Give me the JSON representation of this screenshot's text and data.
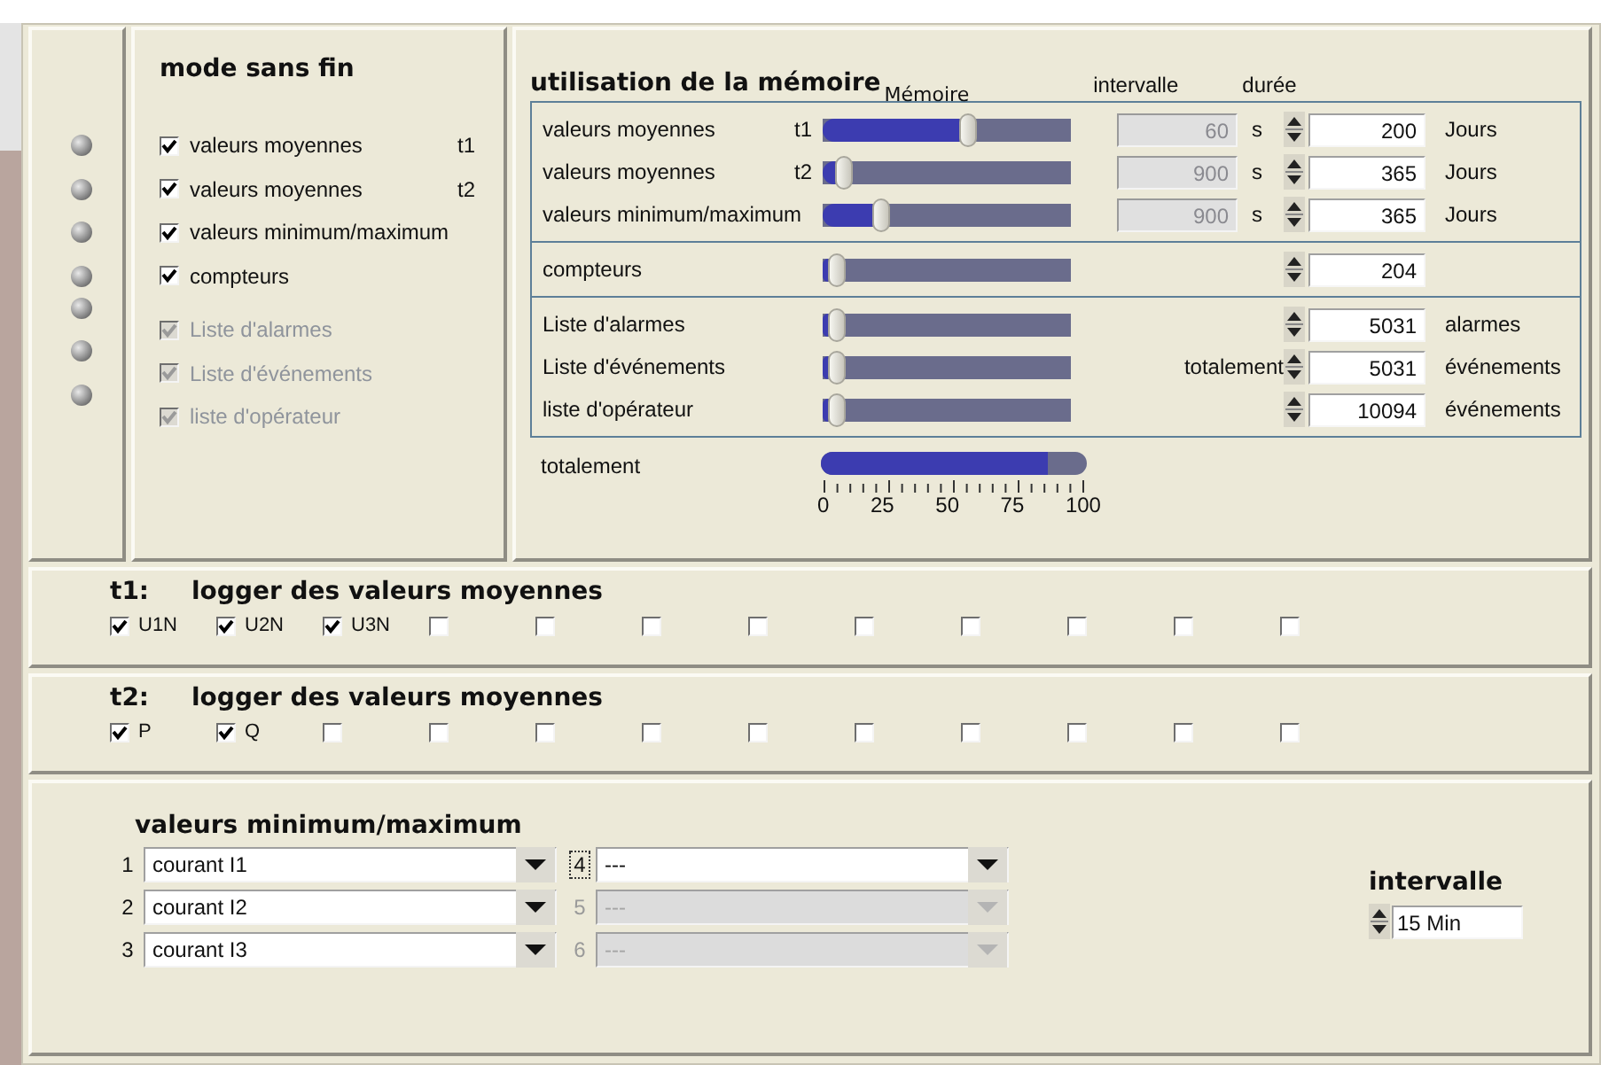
{
  "mode_panel": {
    "title": "mode sans fin",
    "groups": [
      {
        "items": [
          {
            "label": "valeurs moyennes",
            "suffix": "t1",
            "checked": true,
            "disabled": false
          },
          {
            "label": "valeurs moyennes",
            "suffix": "t2",
            "checked": true,
            "disabled": false
          },
          {
            "label": "valeurs minimum/maximum",
            "checked": true,
            "disabled": false
          },
          {
            "label": "compteurs",
            "checked": true,
            "disabled": false
          }
        ]
      },
      {
        "items": [
          {
            "label": "Liste d'alarmes",
            "checked": true,
            "disabled": true
          },
          {
            "label": "Liste d'événements",
            "checked": true,
            "disabled": true
          },
          {
            "label": "liste d'opérateur",
            "checked": true,
            "disabled": true
          }
        ]
      }
    ]
  },
  "memory_panel": {
    "title": "utilisation de la mémoire",
    "headers": [
      "Mémoire",
      "intervalle",
      "durée"
    ],
    "groups": [
      {
        "rows": [
          {
            "label": "valeurs moyennes",
            "tag": "t1",
            "level": 0.55,
            "interval": {
              "value": "60",
              "unit": "s",
              "disabled": true
            },
            "duration": "200",
            "unit": "Jours"
          },
          {
            "label": "valeurs moyennes",
            "tag": "t2",
            "level": 0.05,
            "interval": {
              "value": "900",
              "unit": "s",
              "disabled": true
            },
            "duration": "365",
            "unit": "Jours"
          },
          {
            "label": "valeurs minimum/maximum",
            "level": 0.2,
            "interval": {
              "value": "900",
              "unit": "s",
              "disabled": true
            },
            "duration": "365",
            "unit": "Jours"
          }
        ]
      },
      {
        "rows": [
          {
            "label": "compteurs",
            "level": 0.02,
            "duration": "204"
          }
        ]
      },
      {
        "rows": [
          {
            "label": "Liste d'alarmes",
            "level": 0.02,
            "duration": "5031",
            "unit": "alarmes"
          },
          {
            "label": "Liste d'événements",
            "level": 0.02,
            "side_label": "totalement",
            "duration": "5031",
            "unit": "événements"
          },
          {
            "label": "liste d'opérateur",
            "level": 0.02,
            "duration": "10094",
            "unit": "événements"
          }
        ]
      }
    ],
    "total": {
      "label": "totalement",
      "level": 0.85,
      "ticks": [
        "0",
        "25",
        "50",
        "75",
        "100"
      ]
    }
  },
  "loggers": [
    {
      "tag": "t1:",
      "title": "logger des valeurs moyennes",
      "channels": [
        {
          "label": "U1N",
          "checked": true
        },
        {
          "label": "U2N",
          "checked": true
        },
        {
          "label": "U3N",
          "checked": true
        },
        {
          "checked": false
        },
        {
          "checked": false
        },
        {
          "checked": false
        },
        {
          "checked": false
        },
        {
          "checked": false
        },
        {
          "checked": false
        },
        {
          "checked": false
        },
        {
          "checked": false
        },
        {
          "checked": false
        }
      ]
    },
    {
      "tag": "t2:",
      "title": "logger des valeurs moyennes",
      "channels": [
        {
          "label": "P",
          "checked": true
        },
        {
          "label": "Q",
          "checked": true
        },
        {
          "checked": false
        },
        {
          "checked": false
        },
        {
          "checked": false
        },
        {
          "checked": false
        },
        {
          "checked": false
        },
        {
          "checked": false
        },
        {
          "checked": false
        },
        {
          "checked": false
        },
        {
          "checked": false
        },
        {
          "checked": false
        }
      ]
    }
  ],
  "minmax_panel": {
    "title": "valeurs minimum/maximum",
    "selects": [
      {
        "index": "1",
        "value": "courant I1",
        "disabled": false,
        "focused": false
      },
      {
        "index": "2",
        "value": "courant I2",
        "disabled": false,
        "focused": false
      },
      {
        "index": "3",
        "value": "courant I3",
        "disabled": false,
        "focused": false
      },
      {
        "index": "4",
        "value": "---",
        "disabled": false,
        "focused": true
      },
      {
        "index": "5",
        "value": "---",
        "disabled": true,
        "focused": false
      },
      {
        "index": "6",
        "value": "---",
        "disabled": true,
        "focused": false
      }
    ],
    "interval": {
      "title": "intervalle",
      "value": "15 Min"
    }
  }
}
